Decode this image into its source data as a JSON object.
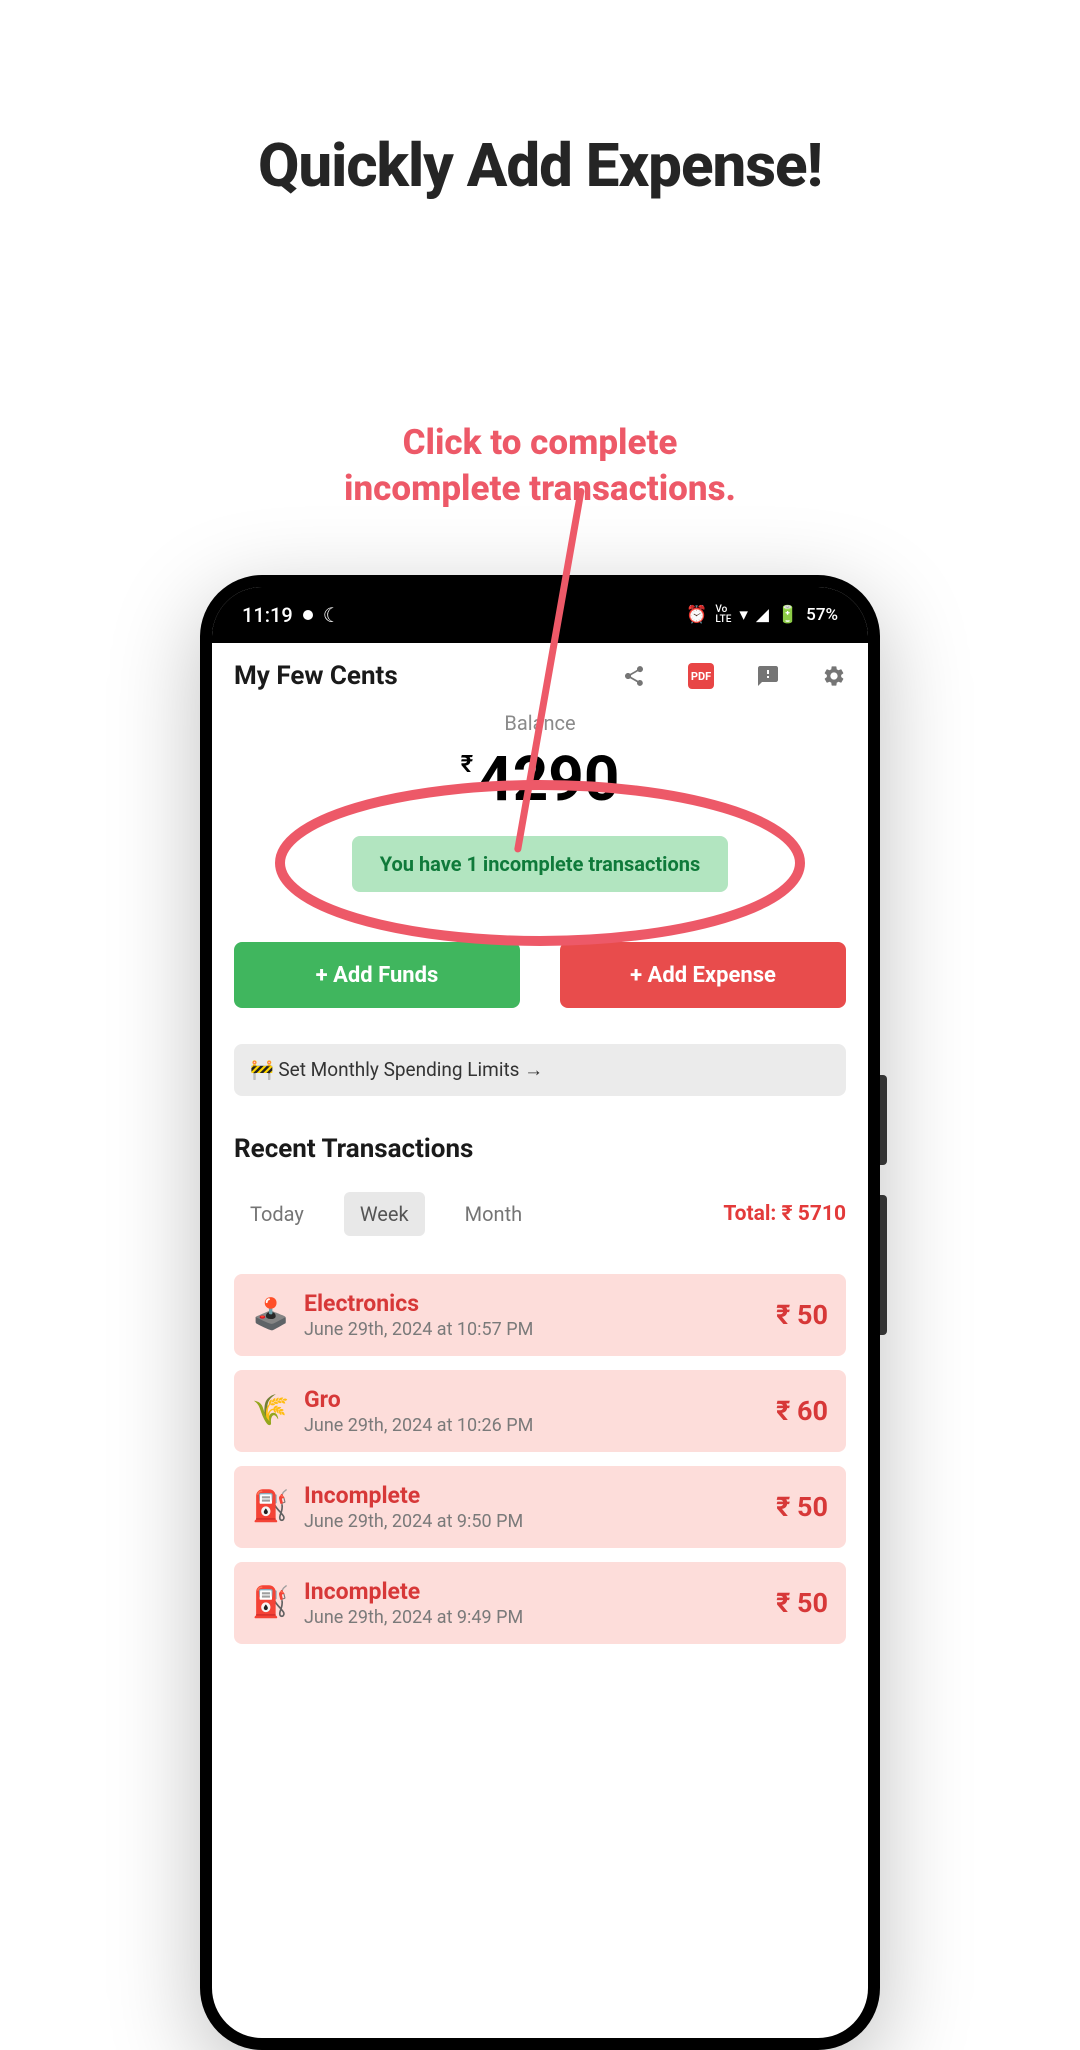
{
  "promo": {
    "title": "Quickly Add Expense!",
    "callout_line1": "Click to complete",
    "callout_line2": "incomplete transactions."
  },
  "status": {
    "time": "11:19",
    "battery": "57%"
  },
  "header": {
    "title": "My Few Cents",
    "pdf_label": "PDF"
  },
  "balance": {
    "label": "Balance",
    "currency": "₹",
    "amount": "4290",
    "incomplete_msg": "You have 1 incomplete transactions"
  },
  "actions": {
    "add_funds": "+ Add Funds",
    "add_expense": "+ Add Expense"
  },
  "limits": {
    "text": "🚧 Set Monthly Spending Limits →"
  },
  "recent": {
    "title": "Recent Transactions",
    "filters": {
      "today": "Today",
      "week": "Week",
      "month": "Month"
    },
    "total_label": "Total: ₹ 5710"
  },
  "transactions": [
    {
      "icon": "🕹️",
      "title": "Electronics",
      "time": "June 29th, 2024 at 10:57 PM",
      "amount": "₹ 50"
    },
    {
      "icon": "🌾",
      "title": "Gro",
      "time": "June 29th, 2024 at 10:26 PM",
      "amount": "₹ 60"
    },
    {
      "icon": "⛽",
      "title": "Incomplete",
      "time": "June 29th, 2024 at 9:50 PM",
      "amount": "₹ 50"
    },
    {
      "icon": "⛽",
      "title": "Incomplete",
      "time": "June 29th, 2024 at 9:49 PM",
      "amount": "₹ 50"
    }
  ]
}
